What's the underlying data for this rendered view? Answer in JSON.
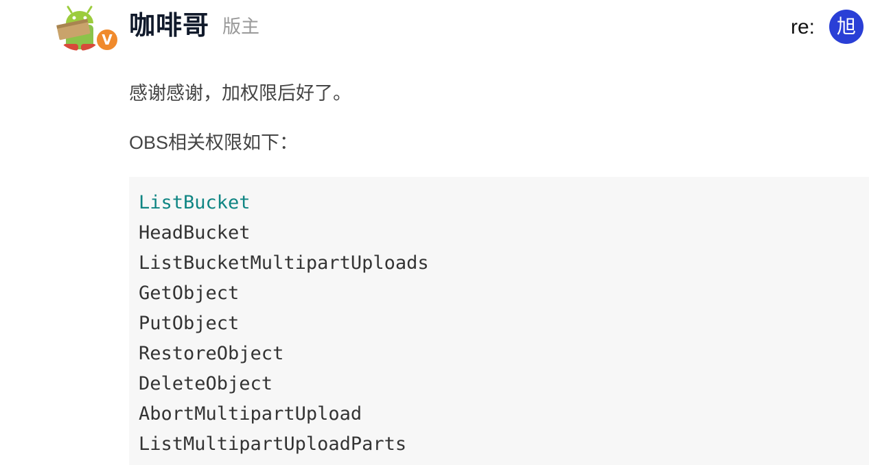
{
  "post": {
    "author": {
      "name": "咖啡哥",
      "role": "版主",
      "badge_letter": "V",
      "avatar_icon": "android-robot-avatar"
    },
    "reply": {
      "label": "re:",
      "avatar_char": "旭",
      "avatar_color": "#2a3fd6"
    },
    "paragraphs": [
      "感谢感谢，加权限后好了。",
      "OBS相关权限如下："
    ],
    "code_lines": [
      "ListBucket",
      "HeadBucket",
      "ListBucketMultipartUploads",
      "GetObject",
      "PutObject",
      "RestoreObject",
      "DeleteObject",
      "AbortMultipartUpload",
      "ListMultipartUploadParts"
    ],
    "colors": {
      "code_background": "#f7f7f7",
      "code_highlight": "#0f8583",
      "badge": "#f08a2c"
    }
  }
}
